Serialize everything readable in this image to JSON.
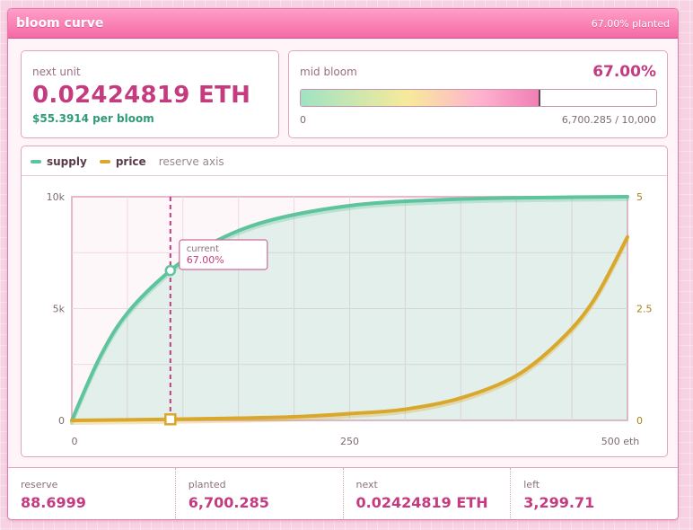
{
  "window": {
    "title": "bloom curve",
    "status": "67.00% planted"
  },
  "next_unit": {
    "label": "next unit",
    "value": "0.02424819 ETH",
    "per_bloom": "$55.3914 per bloom"
  },
  "bloom": {
    "label": "mid bloom",
    "percent": "67.00%",
    "progress": 0.67,
    "min_label": "0",
    "range_label": "6,700.285 / 10,000"
  },
  "legend": {
    "supply": "supply",
    "price": "price",
    "note": "reserve axis"
  },
  "colors": {
    "supply": "#5ec49d",
    "price": "#d9a72b",
    "accent": "#c43c7f"
  },
  "chart_data": {
    "type": "line",
    "x_label": "",
    "y_left_ticks": [
      "10k",
      "5k",
      "0"
    ],
    "y_right_ticks": [
      "5",
      "2.5",
      "0"
    ],
    "x_ticks": [
      "0",
      "250",
      "500 eth"
    ],
    "x_range": [
      0,
      500
    ],
    "y_left_range": [
      0,
      10000
    ],
    "y_right_range": [
      0,
      5
    ],
    "series": [
      {
        "name": "supply",
        "axis": "left",
        "x": [
          0,
          25,
          50,
          88.7,
          125,
          175,
          250,
          325,
          400,
          500
        ],
        "y": [
          0,
          2800,
          4800,
          6700,
          7900,
          8900,
          9600,
          9850,
          9950,
          10000
        ]
      },
      {
        "name": "price",
        "axis": "right",
        "x": [
          0,
          88.7,
          150,
          200,
          250,
          300,
          350,
          400,
          440,
          470,
          500
        ],
        "y": [
          0,
          0.024,
          0.05,
          0.08,
          0.15,
          0.25,
          0.5,
          1.0,
          1.8,
          2.7,
          4.1
        ]
      }
    ],
    "current": {
      "x": 88.7,
      "label_title": "current",
      "label_value": "67.00%"
    }
  },
  "footer": [
    {
      "label": "reserve",
      "value": "88.6999"
    },
    {
      "label": "planted",
      "value": "6,700.285"
    },
    {
      "label": "next",
      "value": "0.02424819 ETH"
    },
    {
      "label": "left",
      "value": "3,299.71"
    }
  ]
}
